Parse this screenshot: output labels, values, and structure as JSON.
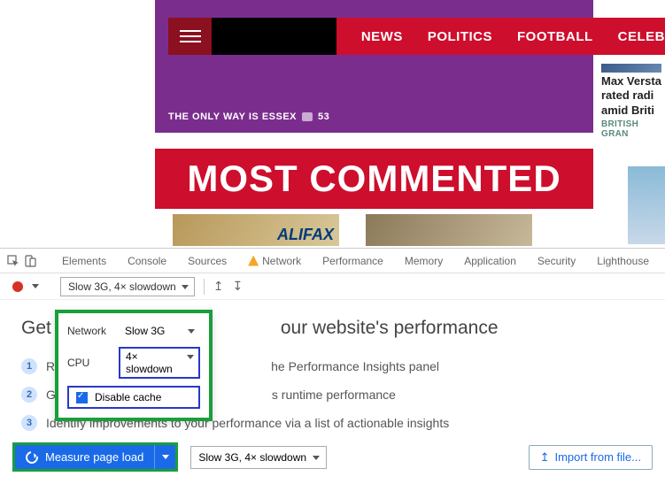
{
  "webpage": {
    "nav": [
      "NEWS",
      "POLITICS",
      "FOOTBALL",
      "CELEB"
    ],
    "tagline": "THE ONLY WAY IS ESSEX",
    "comment_count": "53",
    "sidebar_story": {
      "title": "Max Versta rated radi amid Briti",
      "category": "BRITISH GRAN"
    },
    "most_commented": "MOST COMMENTED",
    "halifax": "ALIFAX"
  },
  "devtools": {
    "tabs": [
      "Elements",
      "Console",
      "Sources",
      "Network",
      "Performance",
      "Memory",
      "Application",
      "Security",
      "Lighthouse"
    ],
    "toolbar_throttle": "Slow 3G, 4× slowdown",
    "panel": {
      "title_prefix": "Get a",
      "title_suffix": "our website's performance",
      "steps": [
        "R",
        "G",
        "Identify improvements to your performance via a list of actionable insights"
      ],
      "step_suffix_1": "he Performance Insights panel",
      "step_suffix_2": "s runtime performance"
    },
    "popover": {
      "network_label": "Network",
      "network_value": "Slow 3G",
      "cpu_label": "CPU",
      "cpu_value": "4× slowdown",
      "disable_cache": "Disable cache"
    },
    "bottom": {
      "measure": "Measure page load",
      "throttle": "Slow 3G, 4× slowdown",
      "import": "Import from file..."
    }
  }
}
